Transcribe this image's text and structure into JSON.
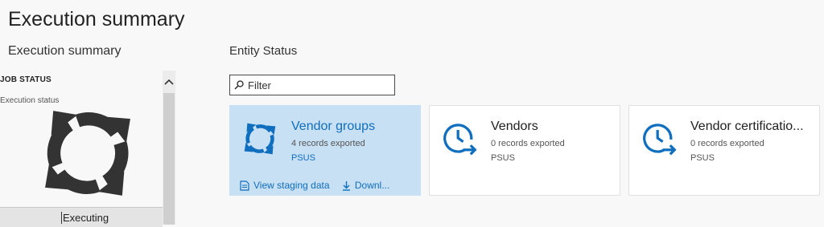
{
  "page": {
    "title": "Execution summary"
  },
  "left": {
    "heading": "Execution summary",
    "job_status_label": "JOB STATUS",
    "execution_status_label": "Execution status",
    "status_icon": "refresh-icon",
    "status_value": "Executing"
  },
  "entity": {
    "heading": "Entity Status",
    "filter": {
      "placeholder": "Filter",
      "value": ""
    },
    "cards": [
      {
        "title": "Vendor groups",
        "subtitle": "4 records exported",
        "company": "PSUS",
        "icon": "refresh-icon",
        "selected": true,
        "actions": {
          "view_staging": "View staging data",
          "download": "Downl..."
        }
      },
      {
        "title": "Vendors",
        "subtitle": "0 records exported",
        "company": "PSUS",
        "icon": "clock-arrow-icon",
        "selected": false
      },
      {
        "title": "Vendor certificatio...",
        "subtitle": "0 records exported",
        "company": "PSUS",
        "icon": "clock-arrow-icon",
        "selected": false
      }
    ]
  },
  "colors": {
    "accent": "#106ebe",
    "selected_card": "#c7e0f4",
    "background": "#f8f8f8",
    "icon_dark": "#333333"
  }
}
